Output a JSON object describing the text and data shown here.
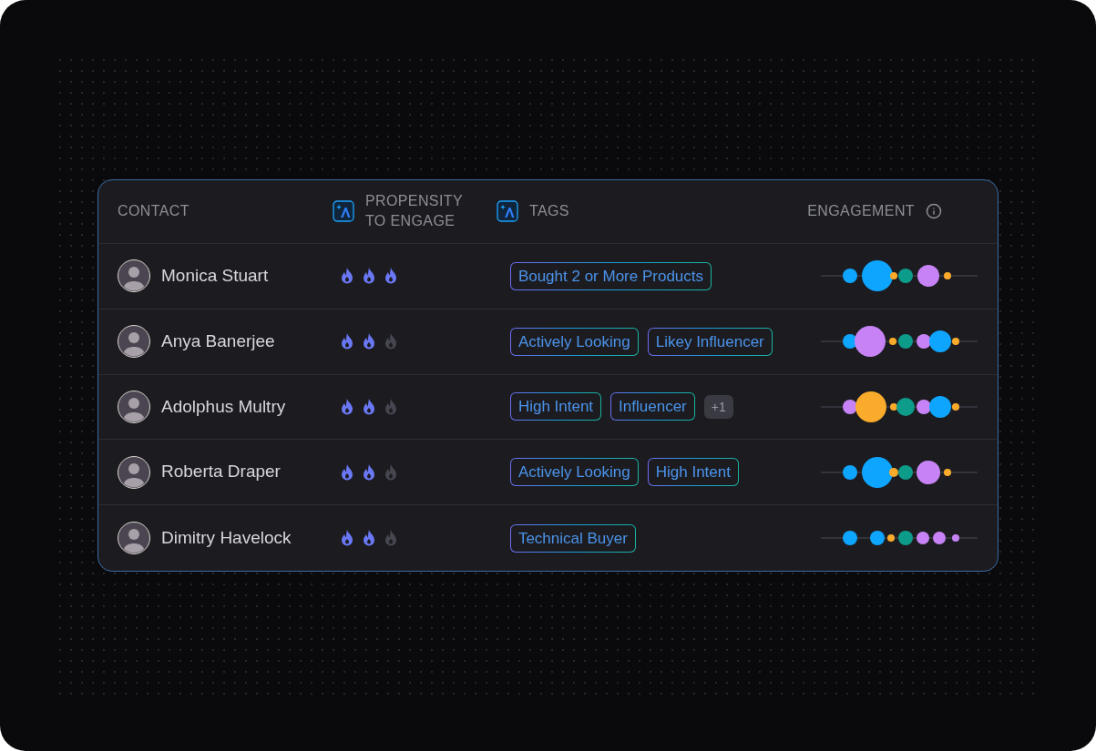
{
  "table": {
    "columns": [
      {
        "label": "CONTACT",
        "kind": "plain"
      },
      {
        "label": "PROPENSITY TO ENGAGE",
        "kind": "ai"
      },
      {
        "label": "TAGS",
        "kind": "ai"
      },
      {
        "label": "ENGAGEMENT",
        "kind": "info"
      }
    ],
    "rows": [
      {
        "name": "Monica Stuart",
        "stars": 3,
        "tags": [
          {
            "label": "Bought 2 or More Products",
            "kind": "tag"
          }
        ]
      },
      {
        "name": "Anya Banerjee",
        "stars": 2,
        "tags": [
          {
            "label": "Actively Looking",
            "kind": "tag"
          },
          {
            "label": "Likey Influencer",
            "kind": "tag"
          }
        ]
      },
      {
        "name": "Adolphus Multry",
        "stars": 2,
        "tags": [
          {
            "label": "High Intent",
            "kind": "tag"
          },
          {
            "label": "Influencer",
            "kind": "tag"
          },
          {
            "label": "+1",
            "kind": "more"
          }
        ]
      },
      {
        "name": "Roberta Draper",
        "stars": 2,
        "tags": [
          {
            "label": "Actively Looking",
            "kind": "tag"
          },
          {
            "label": "High Intent",
            "kind": "tag"
          }
        ]
      },
      {
        "name": "Dimitry Havelock",
        "stars": 2,
        "tags": [
          {
            "label": "Technical Buyer",
            "kind": "tag"
          }
        ]
      }
    ]
  }
}
